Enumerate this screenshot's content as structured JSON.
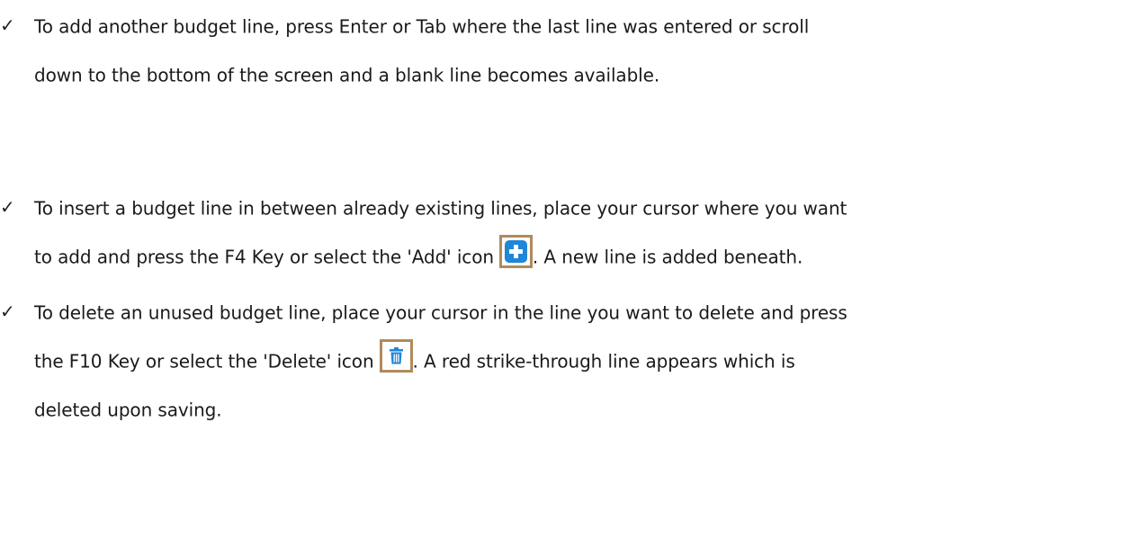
{
  "bullets": [
    {
      "lines": [
        "To add another budget line, press Enter or Tab where the last line was entered or scroll",
        "down to the bottom of the screen and a blank line becomes available."
      ]
    },
    {
      "line1": "To insert a budget line in between already existing lines, place your cursor where you want",
      "line2_before": "to add and press the F4 Key or select the 'Add' icon",
      "line2_after": ".  A new line is added beneath.",
      "icon": "add-plus-icon"
    },
    {
      "line1": "To delete an unused budget line, place your cursor in the line you want to delete and press",
      "line2_before": "the F10 Key or select the 'Delete' icon",
      "line2_after": ".  A red strike-through line appears which is",
      "line3": "deleted upon saving.",
      "icon": "trash-can-icon"
    }
  ],
  "check_glyph": "✓",
  "colors": {
    "text": "#1a1a1a",
    "icon_border": "#b08a5c",
    "icon_blue": "#1f86d8"
  }
}
